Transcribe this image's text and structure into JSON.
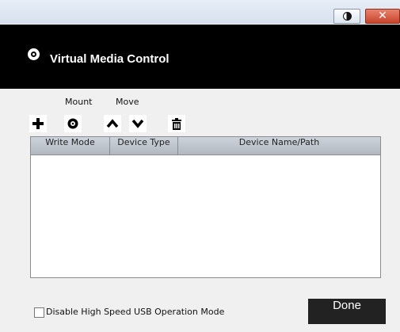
{
  "window": {
    "title_bar_controls": {
      "toggle_icon": "contrast-toggle-icon",
      "close_icon": "close-icon",
      "close_color": "#c8432a"
    }
  },
  "header": {
    "title": "Virtual Media Control",
    "icon": "disc-icon",
    "background": "#000000"
  },
  "toolbar": {
    "mount_label": "Mount",
    "move_label": "Move",
    "buttons": [
      {
        "icon": "add-icon"
      },
      {
        "icon": "disc-icon"
      },
      {
        "icon": "chevron-up-icon"
      },
      {
        "icon": "chevron-down-icon"
      },
      {
        "icon": "trash-icon"
      }
    ]
  },
  "table": {
    "columns": [
      "Write Mode",
      "Device Type",
      "Device Name/Path"
    ],
    "rows": []
  },
  "footer": {
    "checkbox_label": "Disable High Speed USB Operation Mode",
    "checkbox_checked": false,
    "done_label": "Done"
  }
}
